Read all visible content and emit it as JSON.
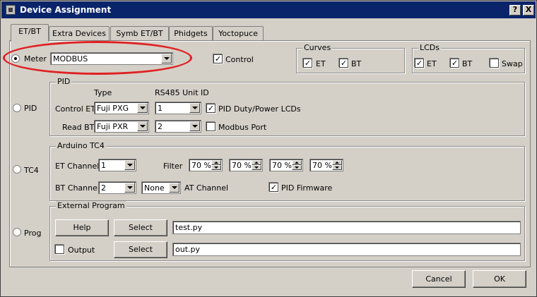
{
  "window": {
    "title": "Device Assignment",
    "help_btn": "?",
    "close_btn": "X"
  },
  "tabs": [
    {
      "label": "ET/BT"
    },
    {
      "label": "Extra Devices"
    },
    {
      "label": "Symb ET/BT"
    },
    {
      "label": "Phidgets"
    },
    {
      "label": "Yoctopuce"
    }
  ],
  "meter": {
    "label": "Meter",
    "value": "MODBUS",
    "control_label": "Control"
  },
  "curves": {
    "title": "Curves",
    "et": "ET",
    "bt": "BT"
  },
  "lcds": {
    "title": "LCDs",
    "et": "ET",
    "bt": "BT",
    "swap": "Swap"
  },
  "pid": {
    "radio_label": "PID",
    "group_title": "PID",
    "type_header": "Type",
    "unit_header": "RS485 Unit ID",
    "control_et_label": "Control ET",
    "control_et_type": "Fuji PXG",
    "control_et_unit": "1",
    "read_bt_label": "Read BT",
    "read_bt_type": "Fuji PXR",
    "read_bt_unit": "2",
    "duty_label": "PID Duty/Power LCDs",
    "modbus_label": "Modbus Port"
  },
  "tc4": {
    "radio_label": "TC4",
    "group_title": "Arduino TC4",
    "et_channel_label": "ET Channel",
    "et_channel": "1",
    "filter_label": "Filter",
    "filters": [
      "70 %",
      "70 %",
      "70 %",
      "70 %"
    ],
    "bt_channel_label": "BT Channel",
    "bt_channel": "2",
    "at_channel": "None",
    "at_channel_label": "AT Channel",
    "pid_firmware_label": "PID Firmware"
  },
  "prog": {
    "radio_label": "Prog",
    "group_title": "External Program",
    "help_btn": "Help",
    "select_btn": "Select",
    "program_path": "test.py",
    "output_label": "Output",
    "output_select_btn": "Select",
    "output_path": "out.py"
  },
  "footer": {
    "cancel": "Cancel",
    "ok": "OK"
  },
  "check_mark": "✓"
}
